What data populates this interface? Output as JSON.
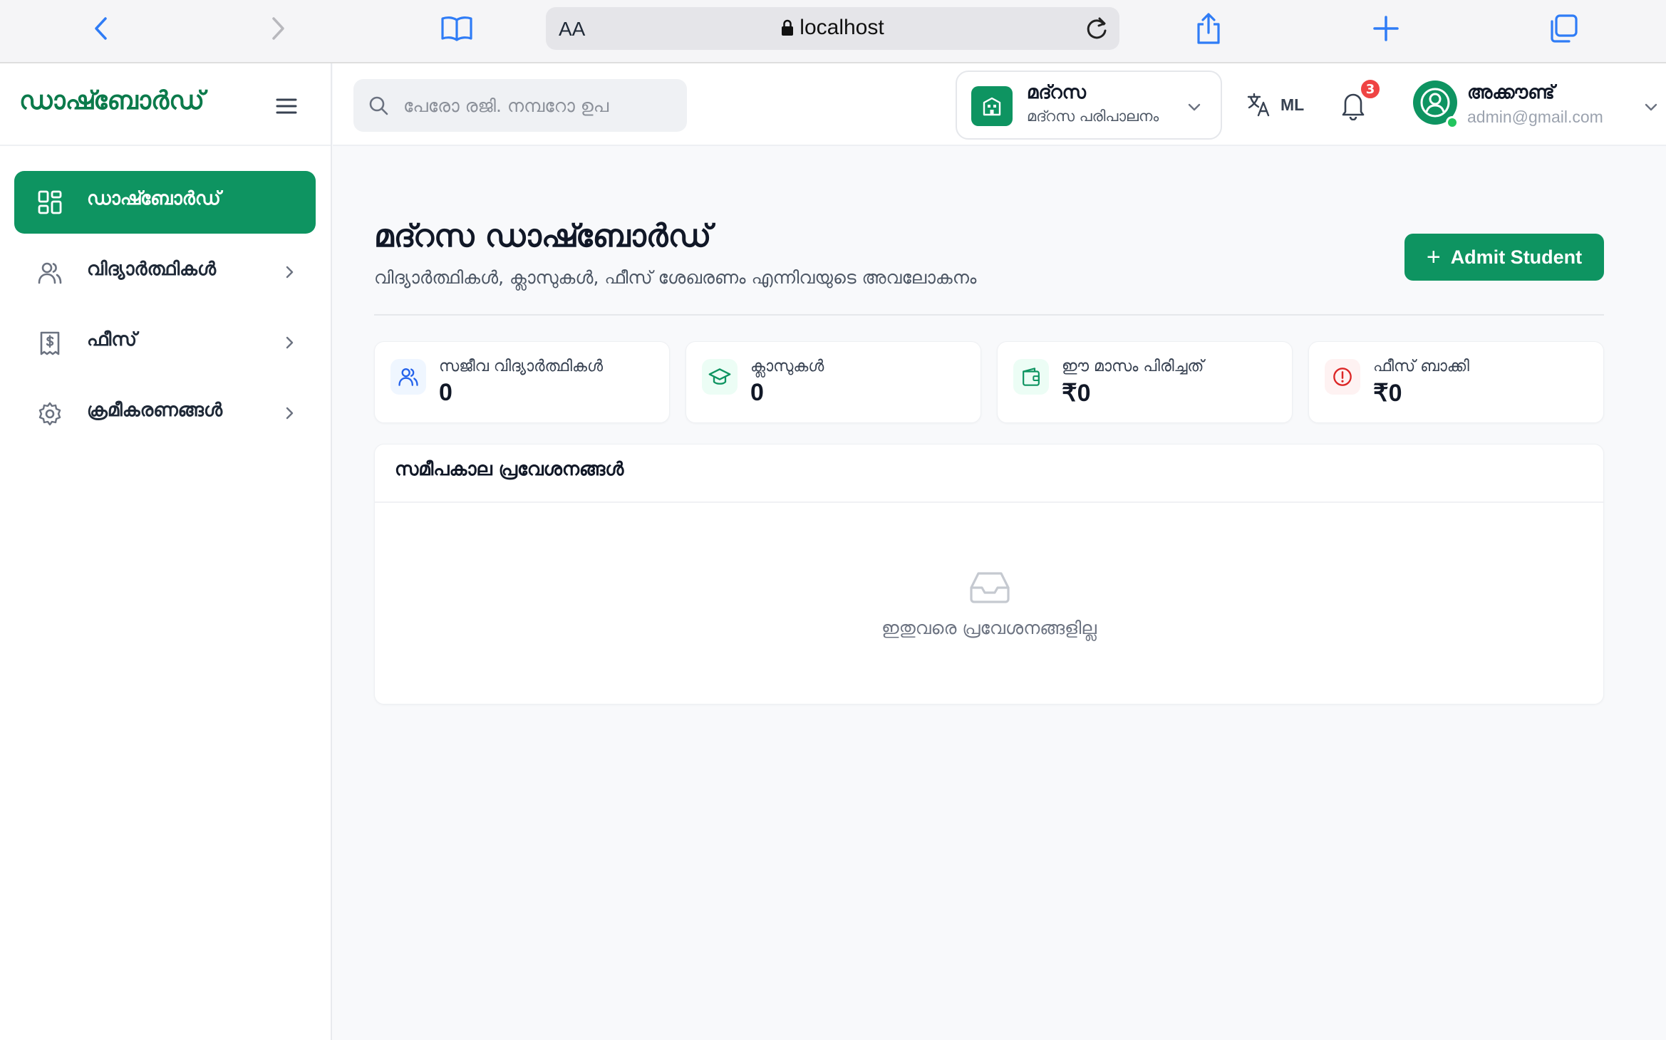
{
  "browser": {
    "aa_label": "AA",
    "url": "localhost"
  },
  "sidebar": {
    "title": "ഡാഷ്ബോർഡ്",
    "items": [
      {
        "label": "ഡാഷ്ബോർഡ്",
        "icon": "grid-icon",
        "active": true
      },
      {
        "label": "വിദ്യാർത്ഥികൾ",
        "icon": "users-icon"
      },
      {
        "label": "ഫീസ്",
        "icon": "receipt-icon"
      },
      {
        "label": "ക്രമീകരണങ്ങൾ",
        "icon": "gear-icon"
      }
    ]
  },
  "header": {
    "search_placeholder": "പേരോ രജി. നമ്പറോ ഉപ",
    "org": {
      "name": "മദ്റസ",
      "subtitle": "മദ്റസ പരിപാലനം"
    },
    "language": "ML",
    "notifications_count": "3",
    "account": {
      "name": "അക്കൗണ്ട്",
      "email": "admin@gmail.com"
    }
  },
  "main": {
    "title": "മദ്റസ ഡാഷ്ബോർഡ്",
    "subtitle": "വിദ്യാർത്ഥികൾ, ക്ലാസുകൾ, ഫീസ് ശേഖരണം എന്നിവയുടെ അവലോകനം",
    "admit_button": "Admit Student",
    "stats": [
      {
        "label": "സജീവ വിദ്യാർത്ഥികൾ",
        "value": "0",
        "icon": "users-icon",
        "color": "#2563eb"
      },
      {
        "label": "ക്ലാസുകൾ",
        "value": "0",
        "icon": "graduation-cap-icon",
        "color": "#0e9461"
      },
      {
        "label": "ഈ മാസം പിരിച്ചത്",
        "value": "₹0",
        "icon": "wallet-icon",
        "color": "#0e9461"
      },
      {
        "label": "ഫീസ് ബാക്കി",
        "value": "₹0",
        "icon": "alert-circle-icon",
        "color": "#dc2626"
      }
    ],
    "recent": {
      "title": "സമീപകാല പ്രവേശനങ്ങൾ",
      "empty_text": "ഇതുവരെ പ്രവേശനങ്ങളില്ല"
    }
  },
  "colors": {
    "accent": "#0e9461",
    "brand_text": "#0b7a4b",
    "danger": "#ef4444"
  }
}
